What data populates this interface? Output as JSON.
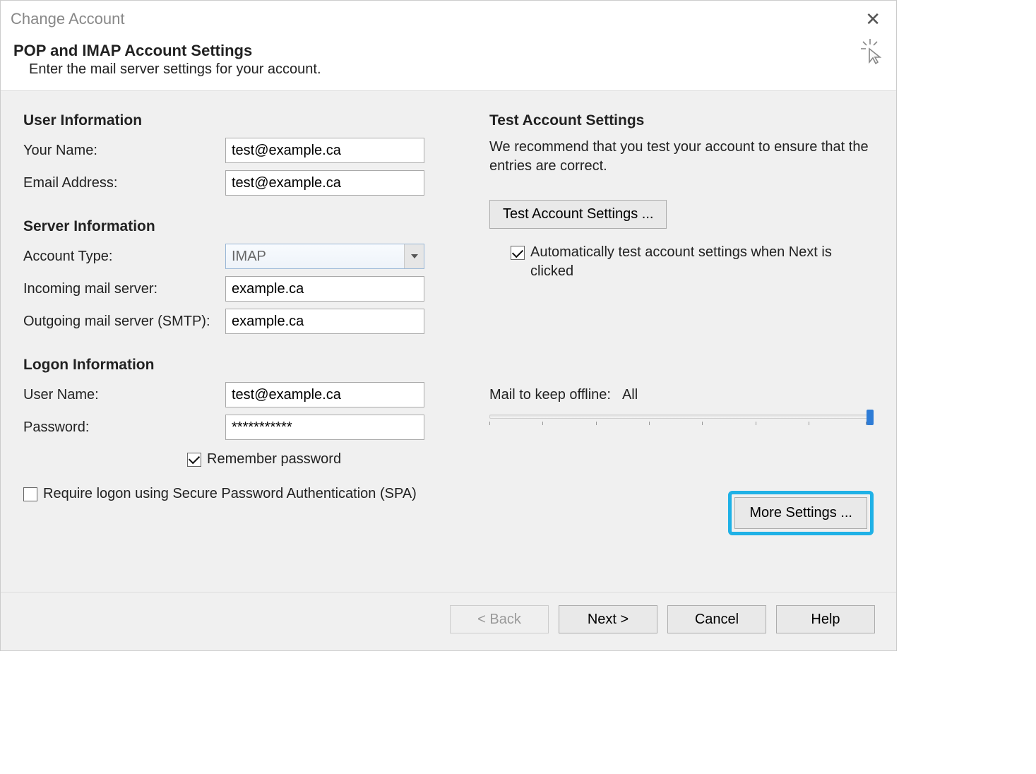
{
  "titlebar": {
    "title": "Change Account"
  },
  "header": {
    "title": "POP and IMAP Account Settings",
    "subtitle": "Enter the mail server settings for your account."
  },
  "sections": {
    "user_info": "User Information",
    "server_info": "Server Information",
    "logon_info": "Logon Information",
    "test_settings": "Test Account Settings"
  },
  "labels": {
    "your_name": "Your Name:",
    "email": "Email Address:",
    "account_type": "Account Type:",
    "incoming": "Incoming mail server:",
    "outgoing": "Outgoing mail server (SMTP):",
    "user_name": "User Name:",
    "password": "Password:",
    "remember": "Remember password",
    "spa": "Require logon using Secure Password Authentication (SPA)",
    "test_desc": "We recommend that you test your account to ensure that the entries are correct.",
    "test_btn": "Test Account Settings ...",
    "auto_test": "Automatically test account settings when Next is clicked",
    "offline_label": "Mail to keep offline:",
    "offline_value": "All",
    "more_settings": "More Settings ..."
  },
  "values": {
    "your_name": "test@example.ca",
    "email": "test@example.ca",
    "account_type": "IMAP",
    "incoming": "example.ca",
    "outgoing": "example.ca",
    "user_name": "test@example.ca",
    "password": "***********"
  },
  "checkboxes": {
    "remember": true,
    "spa": false,
    "auto_test": true
  },
  "footer": {
    "back": "< Back",
    "next": "Next >",
    "cancel": "Cancel",
    "help": "Help"
  }
}
